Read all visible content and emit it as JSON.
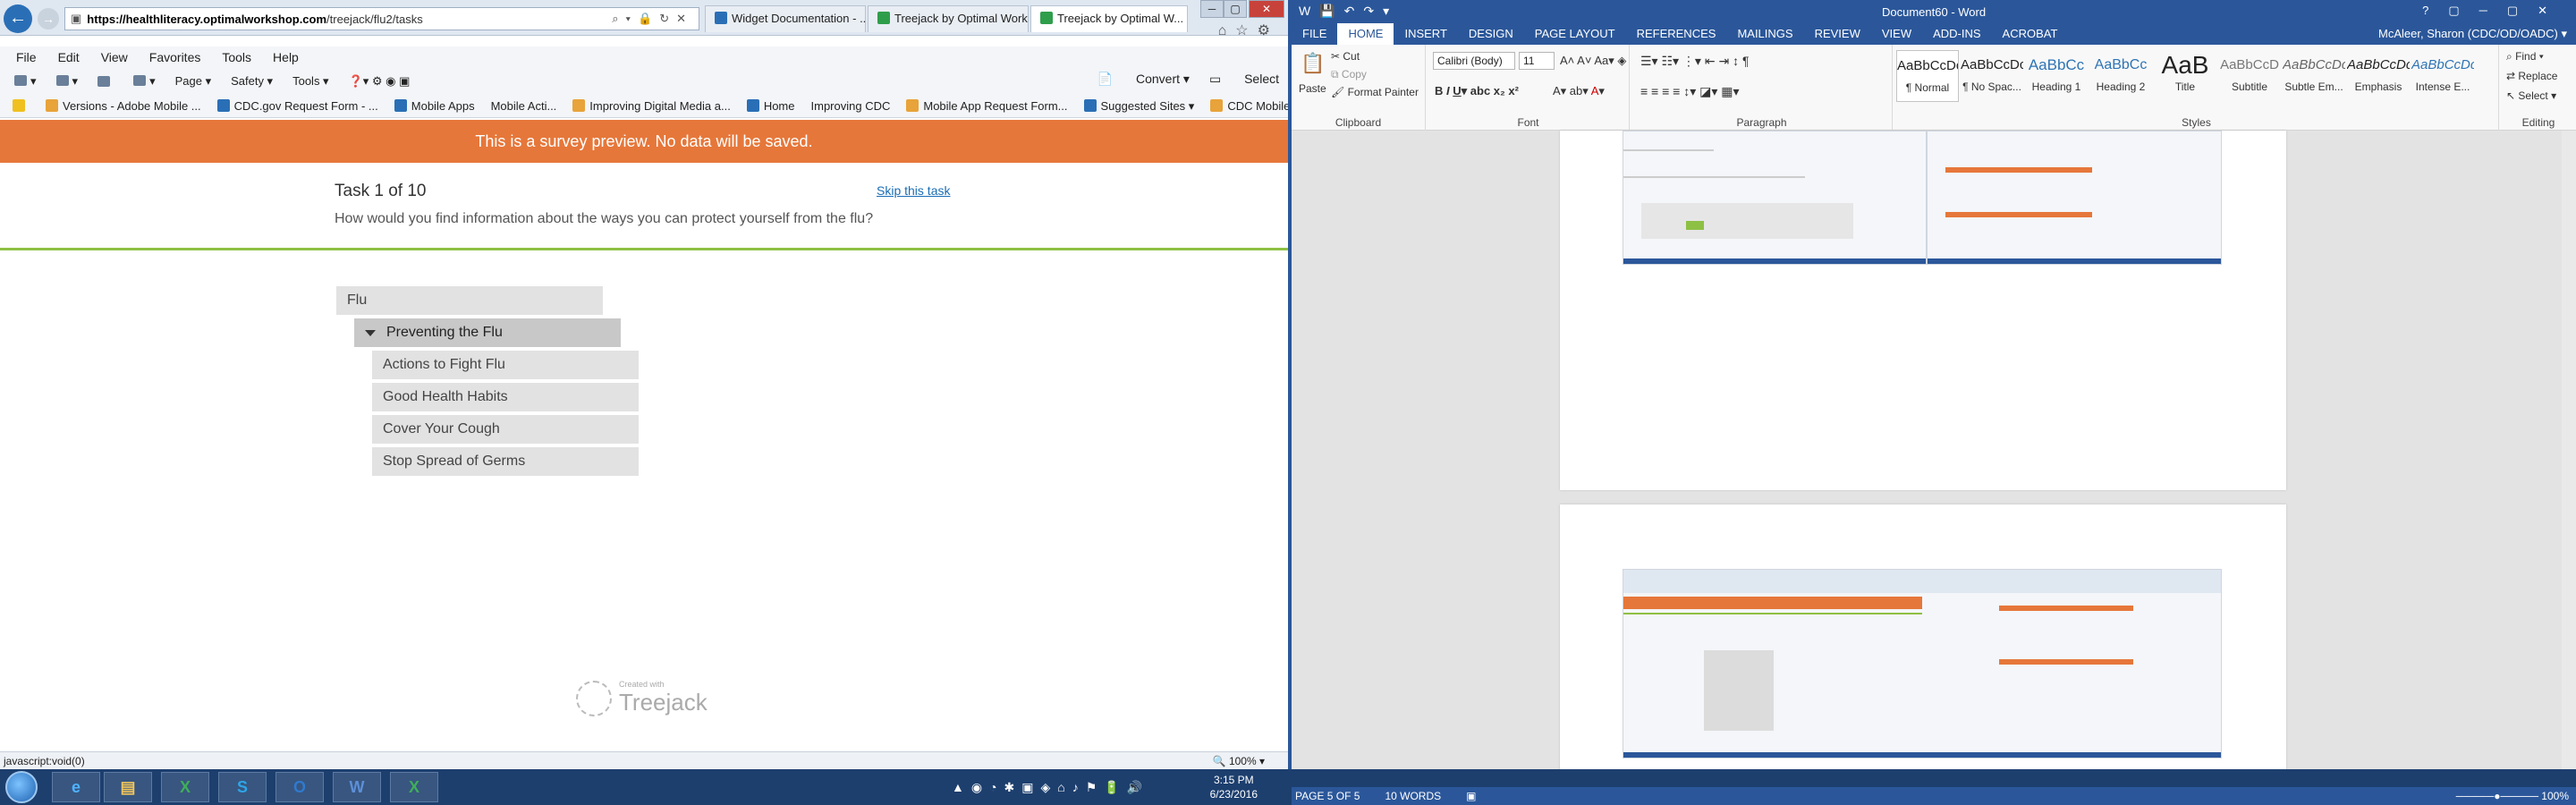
{
  "ie": {
    "url_domain": "https://healthliteracy.optimalworkshop.com",
    "url_path": "/treejack/flu2/tasks",
    "tabs": [
      {
        "label": "Widget Documentation - ..."
      },
      {
        "label": "Treejack by Optimal Works..."
      },
      {
        "label": "Treejack by Optimal W..."
      }
    ],
    "menu": [
      "File",
      "Edit",
      "View",
      "Favorites",
      "Tools",
      "Help"
    ],
    "commands": [
      "Page ▾",
      "Safety ▾",
      "Tools ▾"
    ],
    "convert_label": "Convert",
    "select_label": "Select",
    "favorites": [
      {
        "label": "Versions - Adobe Mobile ..."
      },
      {
        "label": "CDC.gov Request Form - ..."
      },
      {
        "label": "Mobile Apps"
      },
      {
        "label": "Mobile Acti..."
      },
      {
        "label": "Improving Digital Media a..."
      },
      {
        "label": "Home"
      },
      {
        "label": "Improving CDC"
      },
      {
        "label": "Mobile App Request Form..."
      },
      {
        "label": "Suggested Sites ▾"
      },
      {
        "label": "CDC Mobile Applications ..."
      }
    ],
    "status_text": "javascript:void(0)",
    "zoom": "100%"
  },
  "survey": {
    "banner": "This is a survey preview. No data will be saved.",
    "task_title": "Task 1 of 10",
    "skip_label": "Skip this task",
    "question": "How would you find information about the ways you can protect yourself from the flu?",
    "tree": {
      "root": "Flu",
      "expanded": "Preventing the Flu",
      "children": [
        "Actions to Fight Flu",
        "Good Health Habits",
        "Cover Your Cough",
        "Stop Spread of Germs"
      ]
    },
    "created_with": "Created with",
    "brand": "Treejack"
  },
  "word": {
    "doc_title": "Document60 - Word",
    "tabs": [
      "FILE",
      "HOME",
      "INSERT",
      "DESIGN",
      "PAGE LAYOUT",
      "REFERENCES",
      "MAILINGS",
      "REVIEW",
      "VIEW",
      "ADD-INS",
      "ACROBAT"
    ],
    "active_tab": "HOME",
    "user": "McAleer, Sharon (CDC/OD/OADC) ▾",
    "clipboard": {
      "paste": "Paste",
      "cut": "Cut",
      "copy": "Copy",
      "format_painter": "Format Painter",
      "label": "Clipboard"
    },
    "font": {
      "name": "Calibri (Body)",
      "size": "11",
      "label": "Font"
    },
    "paragraph_label": "Paragraph",
    "styles": [
      {
        "sample": "AaBbCcDc",
        "name": "¶ Normal"
      },
      {
        "sample": "AaBbCcDc",
        "name": "¶ No Spac..."
      },
      {
        "sample": "AaBbCc",
        "name": "Heading 1"
      },
      {
        "sample": "AaBbCc",
        "name": "Heading 2"
      },
      {
        "sample": "AaB",
        "name": "Title"
      },
      {
        "sample": "AaBbCcD",
        "name": "Subtitle"
      },
      {
        "sample": "AaBbCcDc",
        "name": "Subtle Em..."
      },
      {
        "sample": "AaBbCcDc",
        "name": "Emphasis"
      },
      {
        "sample": "AaBbCcDc",
        "name": "Intense E..."
      }
    ],
    "styles_label": "Styles",
    "editing": {
      "find": "Find ▾",
      "replace": "Replace",
      "select": "Select ▾",
      "label": "Editing"
    },
    "status": {
      "page": "PAGE 5 OF 5",
      "words": "10 WORDS",
      "zoom": "100%"
    }
  },
  "taskbar": {
    "time": "3:15 PM",
    "date": "6/23/2016"
  }
}
